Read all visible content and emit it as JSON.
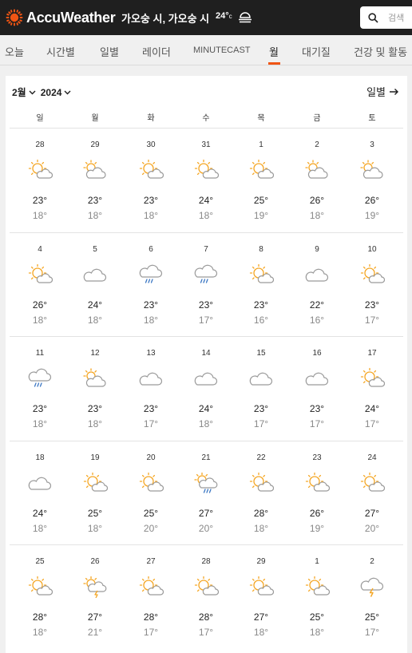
{
  "header": {
    "brand": "AccuWeather",
    "location": "가오숭 시, 가오숭 시",
    "temp": "24°",
    "temp_unit": "c",
    "weather_icon": "fog-icon",
    "search_placeholder": "검색",
    "brand_color": "#f05514"
  },
  "nav": {
    "tabs": [
      {
        "label": "오늘"
      },
      {
        "label": "시간별"
      },
      {
        "label": "일별"
      },
      {
        "label": "레이더"
      },
      {
        "label": "MINUTECAST"
      },
      {
        "label": "월"
      },
      {
        "label": "대기질"
      },
      {
        "label": "건강 및 활동"
      }
    ],
    "active_tab": "월"
  },
  "calendar": {
    "month_label": "2월",
    "year_label": "2024",
    "daily_link": "일별",
    "weekdays": [
      "일",
      "월",
      "화",
      "수",
      "목",
      "금",
      "토"
    ],
    "weeks": [
      [
        {
          "day": "28",
          "icon": "sun-cloud",
          "hi": "23°",
          "lo": "18°"
        },
        {
          "day": "29",
          "icon": "cloud-sun",
          "hi": "23°",
          "lo": "18°"
        },
        {
          "day": "30",
          "icon": "sun-cloud",
          "hi": "23°",
          "lo": "18°"
        },
        {
          "day": "31",
          "icon": "sun-cloud",
          "hi": "24°",
          "lo": "18°"
        },
        {
          "day": "1",
          "icon": "sun-cloud",
          "hi": "25°",
          "lo": "19°"
        },
        {
          "day": "2",
          "icon": "cloud-sun",
          "hi": "26°",
          "lo": "18°"
        },
        {
          "day": "3",
          "icon": "cloud-sun",
          "hi": "26°",
          "lo": "19°"
        }
      ],
      [
        {
          "day": "4",
          "icon": "sun-cloud",
          "hi": "26°",
          "lo": "18°"
        },
        {
          "day": "5",
          "icon": "cloud",
          "hi": "24°",
          "lo": "18°"
        },
        {
          "day": "6",
          "icon": "rain",
          "hi": "23°",
          "lo": "18°"
        },
        {
          "day": "7",
          "icon": "rain",
          "hi": "23°",
          "lo": "17°"
        },
        {
          "day": "8",
          "icon": "sun-cloud",
          "hi": "23°",
          "lo": "16°"
        },
        {
          "day": "9",
          "icon": "cloud",
          "hi": "22°",
          "lo": "16°"
        },
        {
          "day": "10",
          "icon": "sun-cloud",
          "hi": "23°",
          "lo": "17°"
        }
      ],
      [
        {
          "day": "11",
          "icon": "rain",
          "hi": "23°",
          "lo": "18°"
        },
        {
          "day": "12",
          "icon": "cloud-sun",
          "hi": "23°",
          "lo": "18°"
        },
        {
          "day": "13",
          "icon": "cloud",
          "hi": "23°",
          "lo": "17°"
        },
        {
          "day": "14",
          "icon": "cloud",
          "hi": "24°",
          "lo": "18°"
        },
        {
          "day": "15",
          "icon": "cloud",
          "hi": "23°",
          "lo": "17°"
        },
        {
          "day": "16",
          "icon": "cloud",
          "hi": "23°",
          "lo": "17°"
        },
        {
          "day": "17",
          "icon": "sun-cloud",
          "hi": "24°",
          "lo": "17°"
        }
      ],
      [
        {
          "day": "18",
          "icon": "cloud",
          "hi": "24°",
          "lo": "18°"
        },
        {
          "day": "19",
          "icon": "sun-cloud",
          "hi": "25°",
          "lo": "18°"
        },
        {
          "day": "20",
          "icon": "sun-cloud",
          "hi": "25°",
          "lo": "20°"
        },
        {
          "day": "21",
          "icon": "sun-rain",
          "hi": "27°",
          "lo": "20°"
        },
        {
          "day": "22",
          "icon": "sun-cloud",
          "hi": "28°",
          "lo": "18°"
        },
        {
          "day": "23",
          "icon": "sun-cloud",
          "hi": "26°",
          "lo": "19°"
        },
        {
          "day": "24",
          "icon": "sun-cloud",
          "hi": "27°",
          "lo": "20°"
        }
      ],
      [
        {
          "day": "25",
          "icon": "sun-cloud",
          "hi": "28°",
          "lo": "18°"
        },
        {
          "day": "26",
          "icon": "sun-storm",
          "hi": "27°",
          "lo": "21°"
        },
        {
          "day": "27",
          "icon": "sun-cloud",
          "hi": "28°",
          "lo": "17°"
        },
        {
          "day": "28",
          "icon": "sun-cloud",
          "hi": "28°",
          "lo": "17°"
        },
        {
          "day": "29",
          "icon": "sun-cloud",
          "hi": "27°",
          "lo": "18°"
        },
        {
          "day": "1",
          "icon": "sun-cloud",
          "hi": "25°",
          "lo": "18°"
        },
        {
          "day": "2",
          "icon": "storm",
          "hi": "25°",
          "lo": "17°"
        }
      ]
    ]
  }
}
